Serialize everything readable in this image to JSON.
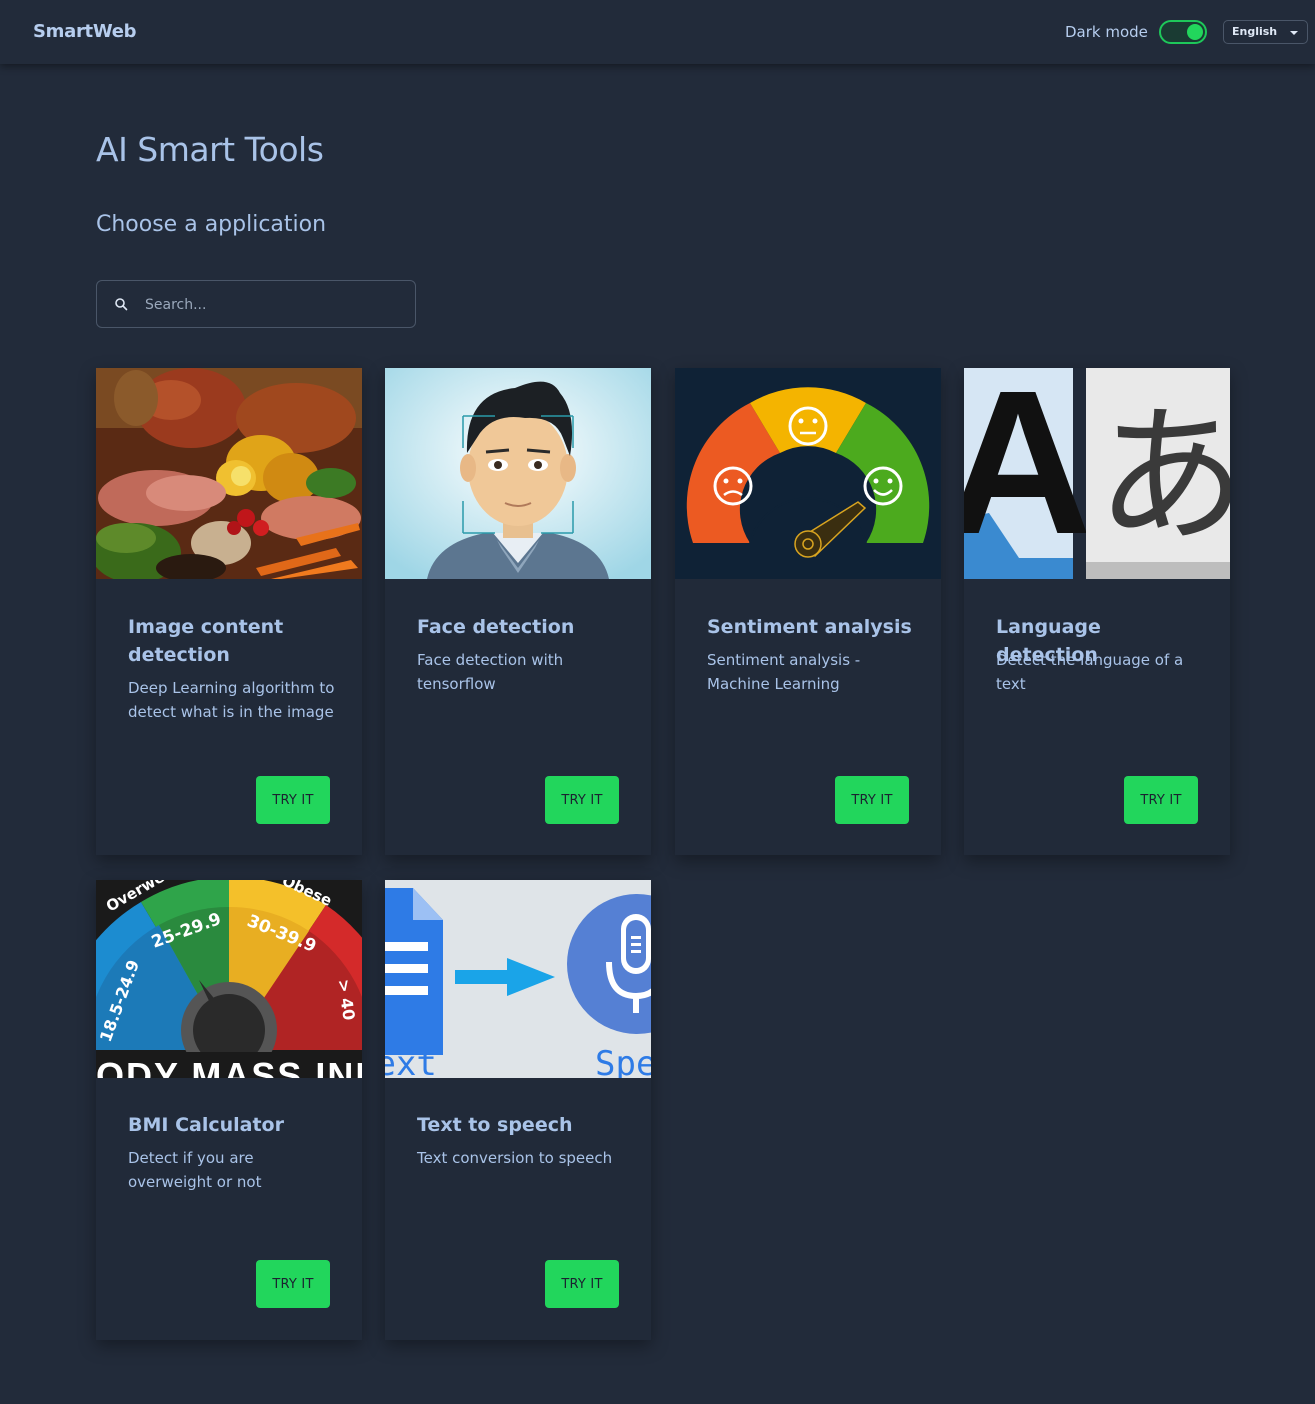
{
  "header": {
    "brand": "SmartWeb",
    "dark_mode_label": "Dark mode",
    "dark_mode_on": true,
    "language": "English"
  },
  "main": {
    "title": "AI Smart Tools",
    "subtitle": "Choose a application",
    "search": {
      "placeholder": "Search...",
      "value": ""
    }
  },
  "cards": [
    {
      "title": "Image content detection",
      "description": "Deep Learning algorithm to detect what is in the image",
      "button": "TRY IT"
    },
    {
      "title": "Face detection",
      "description": "Face detection with tensorflow",
      "button": "TRY IT"
    },
    {
      "title": "Sentiment analysis",
      "description": "Sentiment analysis - Machine Learning",
      "button": "TRY IT"
    },
    {
      "title": "Language detection",
      "description": "Detect the language of a text",
      "button": "TRY IT"
    },
    {
      "title": "BMI Calculator",
      "description": "Detect if you are overweight or not",
      "button": "TRY IT"
    },
    {
      "title": "Text to speech",
      "description": "Text conversion to speech",
      "button": "TRY IT"
    }
  ],
  "images": {
    "language_glyph_latin": "A",
    "language_glyph_japanese": "あ",
    "bmi_ranges": [
      "18.5-24.9",
      "25-29.9",
      "30-39.9",
      "> 40"
    ],
    "bmi_labels": [
      "Overweight",
      "Obese"
    ],
    "bmi_banner": "BODY MASS INDEX",
    "tts_left_word": "Text",
    "tts_right_word": "Speech"
  },
  "colors": {
    "background": "#222b3a",
    "accent_green": "#22d65c",
    "text": "#a9c3e8"
  }
}
